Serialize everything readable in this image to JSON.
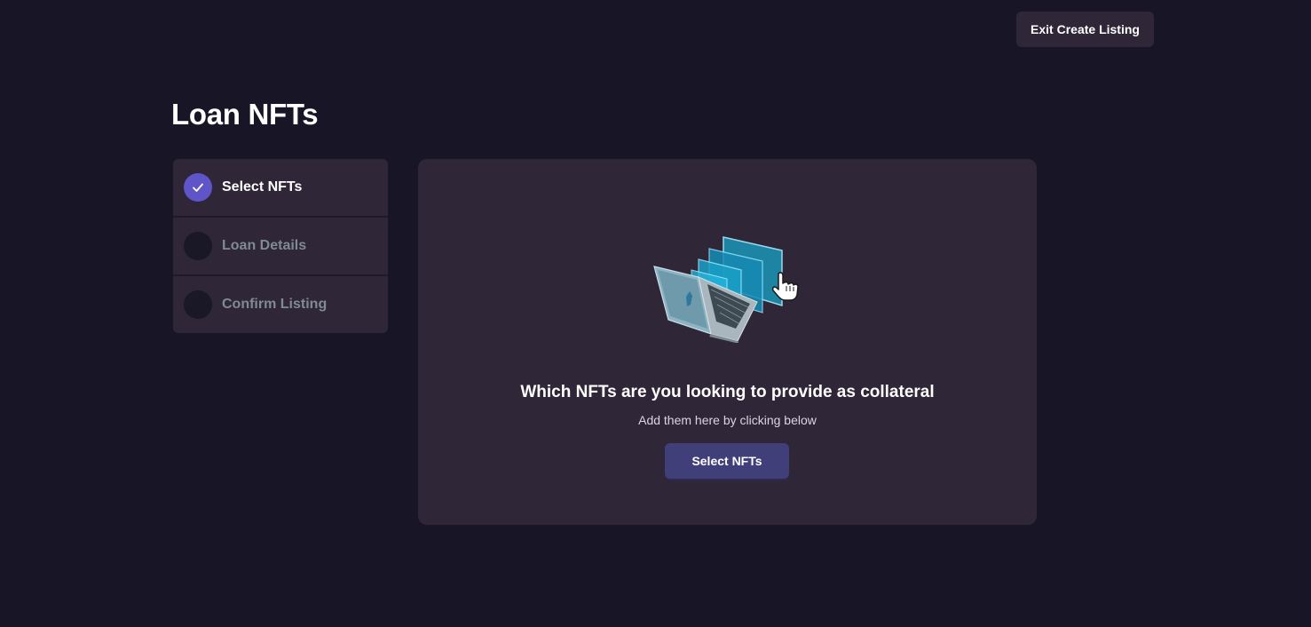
{
  "header": {
    "exit_label": "Exit Create Listing"
  },
  "page": {
    "title": "Loan NFTs"
  },
  "steps": [
    {
      "label": "Select NFTs",
      "state": "complete"
    },
    {
      "label": "Loan Details",
      "state": "pending"
    },
    {
      "label": "Confirm Listing",
      "state": "pending"
    }
  ],
  "panel": {
    "illustration": "laptop-nft-illustration",
    "heading": "Which NFTs are you looking to provide as collateral",
    "subtext": "Add them here by clicking below",
    "button_label": "Select NFTs"
  },
  "colors": {
    "background": "#181626",
    "card": "#2f2637",
    "accent": "#5f54c8",
    "button": "#403f7a",
    "muted_text": "#7e8a96"
  }
}
